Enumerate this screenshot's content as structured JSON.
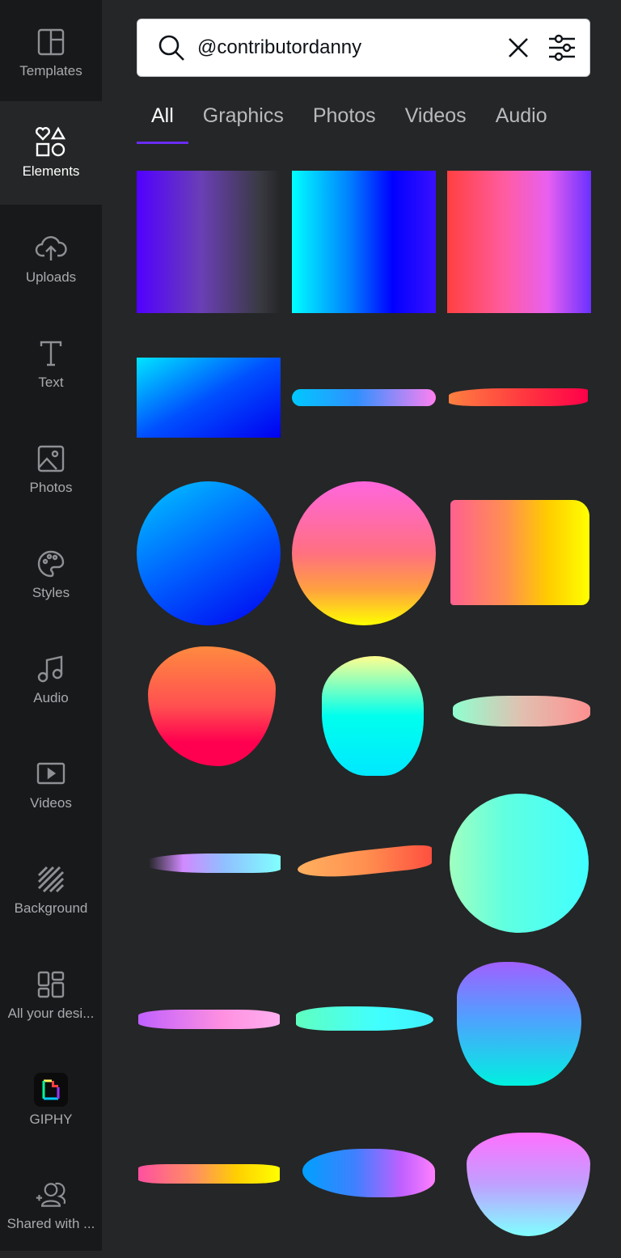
{
  "sidebar": {
    "items": [
      {
        "label": "Templates",
        "icon": "templates-icon"
      },
      {
        "label": "Elements",
        "icon": "elements-icon",
        "active": true
      },
      {
        "label": "Uploads",
        "icon": "upload-cloud-icon"
      },
      {
        "label": "Text",
        "icon": "text-icon"
      },
      {
        "label": "Photos",
        "icon": "photo-icon"
      },
      {
        "label": "Styles",
        "icon": "palette-icon"
      },
      {
        "label": "Audio",
        "icon": "music-note-icon"
      },
      {
        "label": "Videos",
        "icon": "video-icon"
      },
      {
        "label": "Background",
        "icon": "background-stripes-icon"
      },
      {
        "label": "All your desi...",
        "icon": "grid-layout-icon"
      },
      {
        "label": "GIPHY",
        "icon": "giphy-icon"
      },
      {
        "label": "Shared with ...",
        "icon": "shared-users-icon"
      }
    ]
  },
  "search": {
    "value": "@contributordanny",
    "icons": [
      "search-icon",
      "clear-icon",
      "filter-icon"
    ]
  },
  "tabs": [
    {
      "label": "All",
      "active": true
    },
    {
      "label": "Graphics"
    },
    {
      "label": "Photos"
    },
    {
      "label": "Videos"
    },
    {
      "label": "Audio"
    }
  ],
  "colors": {
    "accent": "#6a2cf5",
    "sidebar_bg": "#18191b",
    "panel_bg": "#252627"
  }
}
